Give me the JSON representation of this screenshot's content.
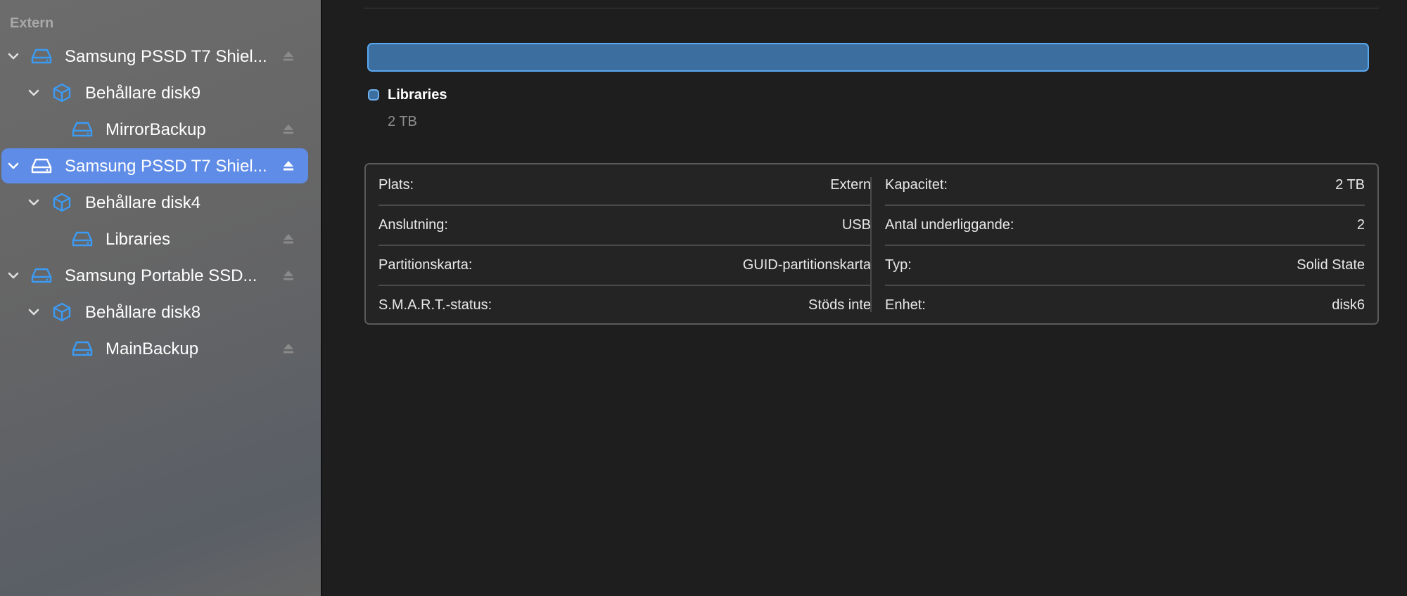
{
  "sidebar": {
    "section": "Extern",
    "items": [
      {
        "label": "Samsung PSSD T7 Shiel...",
        "icon": "external-drive-icon",
        "level": 0,
        "selected": false,
        "eject": true
      },
      {
        "label": "Behållare disk9",
        "icon": "container-cube-icon",
        "level": 1,
        "selected": false,
        "eject": false
      },
      {
        "label": "MirrorBackup",
        "icon": "volume-drive-icon",
        "level": 2,
        "selected": false,
        "eject": true
      },
      {
        "label": "Samsung PSSD T7 Shiel...",
        "icon": "external-drive-icon",
        "level": 0,
        "selected": true,
        "eject": true
      },
      {
        "label": "Behållare disk4",
        "icon": "container-cube-icon",
        "level": 1,
        "selected": false,
        "eject": false
      },
      {
        "label": "Libraries",
        "icon": "volume-drive-icon",
        "level": 2,
        "selected": false,
        "eject": true
      },
      {
        "label": "Samsung Portable SSD...",
        "icon": "external-drive-icon",
        "level": 0,
        "selected": false,
        "eject": true
      },
      {
        "label": "Behållare disk8",
        "icon": "container-cube-icon",
        "level": 1,
        "selected": false,
        "eject": false
      },
      {
        "label": "MainBackup",
        "icon": "volume-drive-icon",
        "level": 2,
        "selected": false,
        "eject": true
      }
    ]
  },
  "usage": {
    "fraction": 1.0,
    "color": "#3c6ea0",
    "legend_name": "Libraries",
    "legend_size": "2 TB"
  },
  "info": {
    "left": [
      {
        "label": "Plats:",
        "value": "Extern"
      },
      {
        "label": "Anslutning:",
        "value": "USB"
      },
      {
        "label": "Partitionskarta:",
        "value": "GUID-partitionskarta"
      },
      {
        "label": "S.M.A.R.T.-status:",
        "value": "Stöds inte"
      }
    ],
    "right": [
      {
        "label": "Kapacitet:",
        "value": "2 TB"
      },
      {
        "label": "Antal underliggande:",
        "value": "2"
      },
      {
        "label": "Typ:",
        "value": "Solid State"
      },
      {
        "label": "Enhet:",
        "value": "disk6"
      }
    ]
  },
  "colors": {
    "accent": "#5f8ce6",
    "icon_blue": "#3b9bf5"
  }
}
